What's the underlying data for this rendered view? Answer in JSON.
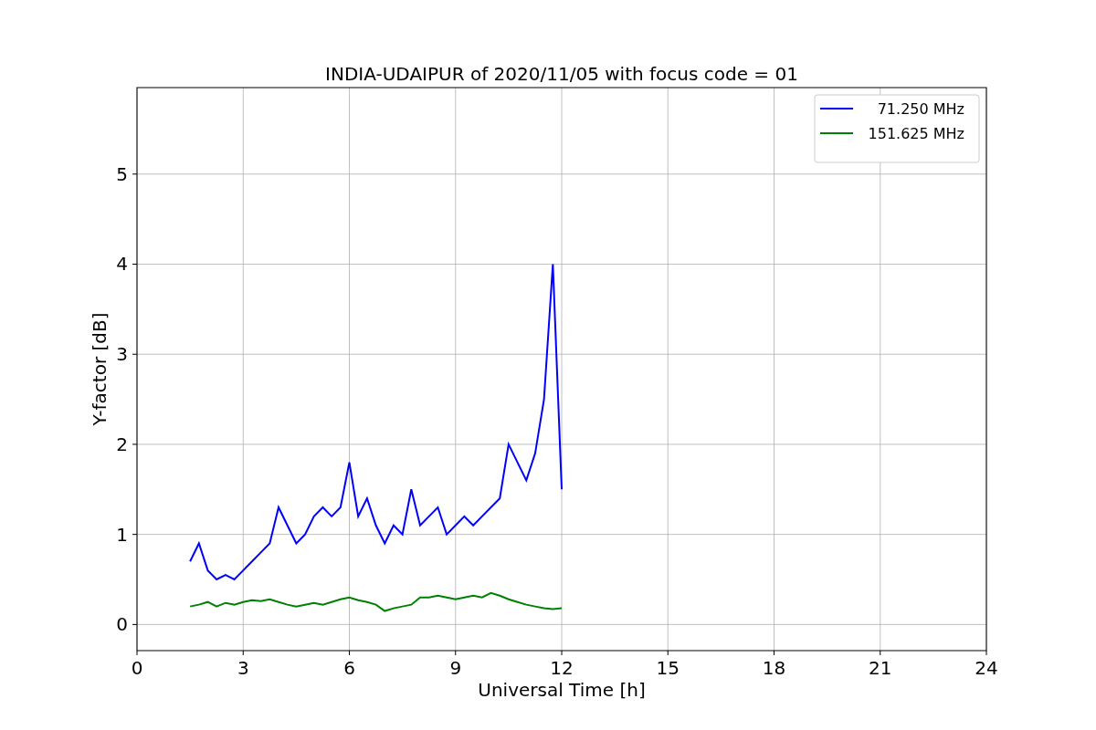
{
  "figure": {
    "chart_data": {
      "type": "line",
      "title": "INDIA-UDAIPUR of 2020/11/05 with focus code = 01",
      "xlabel": "Universal Time [h]",
      "ylabel": "Y-factor [dB]",
      "x": [
        1.5,
        1.75,
        2.0,
        2.25,
        2.5,
        2.75,
        3.0,
        3.25,
        3.5,
        3.75,
        4.0,
        4.25,
        4.5,
        4.75,
        5.0,
        5.25,
        5.5,
        5.75,
        6.0,
        6.25,
        6.5,
        6.75,
        7.0,
        7.25,
        7.5,
        7.75,
        8.0,
        8.25,
        8.5,
        8.75,
        9.0,
        9.25,
        9.5,
        9.75,
        10.0,
        10.25,
        10.5,
        10.75,
        11.0,
        11.25,
        11.5,
        11.75,
        12.0
      ],
      "series": [
        {
          "name": "71.250 MHz",
          "color": "#0000ff",
          "values": [
            0.7,
            0.9,
            0.6,
            0.5,
            0.55,
            0.5,
            0.6,
            0.7,
            0.8,
            0.9,
            1.3,
            1.1,
            0.9,
            1.0,
            1.2,
            1.3,
            1.2,
            1.3,
            1.8,
            1.2,
            1.4,
            1.1,
            0.9,
            1.1,
            1.0,
            1.5,
            1.1,
            1.2,
            1.3,
            1.0,
            1.1,
            1.2,
            1.1,
            1.2,
            1.3,
            1.4,
            2.0,
            1.8,
            1.6,
            1.9,
            2.5,
            4.0,
            1.5
          ]
        },
        {
          "name": "151.625 MHz",
          "color": "#008000",
          "values": [
            0.2,
            0.22,
            0.25,
            0.2,
            0.24,
            0.22,
            0.25,
            0.27,
            0.26,
            0.28,
            0.25,
            0.22,
            0.2,
            0.22,
            0.24,
            0.22,
            0.25,
            0.28,
            0.3,
            0.27,
            0.25,
            0.22,
            0.15,
            0.18,
            0.2,
            0.22,
            0.3,
            0.3,
            0.32,
            0.3,
            0.28,
            0.3,
            0.32,
            0.3,
            0.35,
            0.32,
            0.28,
            0.25,
            0.22,
            0.2,
            0.18,
            0.17,
            0.18
          ]
        }
      ],
      "grid": true,
      "legend": true,
      "xlim": [
        0,
        24
      ],
      "ylim": [
        -0.29,
        5.96
      ],
      "xticks": [
        0,
        3,
        6,
        9,
        12,
        15,
        18,
        21,
        24
      ],
      "yticks": [
        0,
        1,
        2,
        3,
        4,
        5
      ]
    }
  }
}
